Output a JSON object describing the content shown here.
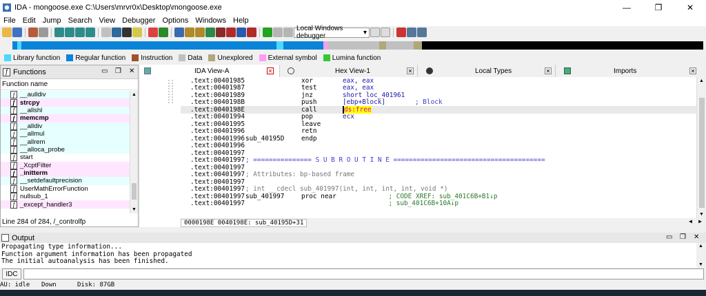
{
  "window": {
    "title": "IDA - mongoose.exe C:\\Users\\mrvr0x\\Desktop\\mongoose.exe",
    "minimize": "—",
    "restore": "❐",
    "close": "✕"
  },
  "menu": [
    "File",
    "Edit",
    "Jump",
    "Search",
    "View",
    "Debugger",
    "Options",
    "Windows",
    "Help"
  ],
  "toolbar": {
    "debugger_select": "Local Windows debugger",
    "icons": [
      "open-icon",
      "save-icon",
      "back-icon",
      "forward-icon",
      "new-icon",
      "copy-icon",
      "paste-icon",
      "edit-icon",
      "jump-icon",
      "text-icon",
      "function-icon",
      "data-icon",
      "struct-icon",
      "letters-icon",
      "ascii-icon",
      "enum-icon",
      "graph-icon",
      "list-icon",
      "run-icon",
      "pause-icon",
      "stop-icon"
    ]
  },
  "legend": [
    {
      "label": "Library function",
      "color": "#4cd8ff"
    },
    {
      "label": "Regular function",
      "color": "#0a84d8"
    },
    {
      "label": "Instruction",
      "color": "#a0522d"
    },
    {
      "label": "Data",
      "color": "#c0c0c0"
    },
    {
      "label": "Unexplored",
      "color": "#b0a87a"
    },
    {
      "label": "External symbol",
      "color": "#ff9cf2"
    },
    {
      "label": "Lumina function",
      "color": "#34c934"
    }
  ],
  "functions_panel": {
    "title": "Functions",
    "column_header": "Function name",
    "items": [
      {
        "name": "__aulldiv",
        "bold": false,
        "bg": "#e6ffff"
      },
      {
        "name": "strcpy",
        "bold": true,
        "bg": "#ffe6ff"
      },
      {
        "name": "__allshl",
        "bold": false,
        "bg": "#e6ffff"
      },
      {
        "name": "memcmp",
        "bold": true,
        "bg": "#ffe6ff"
      },
      {
        "name": "__alldiv",
        "bold": false,
        "bg": "#e6ffff"
      },
      {
        "name": "__allmul",
        "bold": false,
        "bg": "#e6ffff"
      },
      {
        "name": "__allrem",
        "bold": false,
        "bg": "#e6ffff"
      },
      {
        "name": "__alloca_probe",
        "bold": false,
        "bg": "#e6ffff"
      },
      {
        "name": "start",
        "bold": false,
        "bg": "#ffffff"
      },
      {
        "name": "_XcptFilter",
        "bold": false,
        "bg": "#ffe6ff"
      },
      {
        "name": "_initterm",
        "bold": true,
        "bg": "#ffe6ff"
      },
      {
        "name": "__setdefaultprecision",
        "bold": false,
        "bg": "#e6ffff"
      },
      {
        "name": "UserMathErrorFunction",
        "bold": false,
        "bg": "#ffffff"
      },
      {
        "name": "nullsub_1",
        "bold": false,
        "bg": "#ffffff"
      },
      {
        "name": "_except_handler3",
        "bold": false,
        "bg": "#ffe6ff"
      }
    ],
    "status": "Line 284 of 284, /_controlfp"
  },
  "tabs": [
    {
      "label": "IDA View-A",
      "active": true
    },
    {
      "label": "Hex View-1",
      "active": false
    },
    {
      "label": "Local Types",
      "active": false
    },
    {
      "label": "Imports",
      "active": false
    }
  ],
  "disassembly": [
    {
      "addr": ".text:00401985",
      "label": "",
      "mn": "xor",
      "op": "eax, eax",
      "comment": ""
    },
    {
      "addr": ".text:00401987",
      "label": "",
      "mn": "test",
      "op": "eax, eax",
      "comment": ""
    },
    {
      "addr": ".text:00401989",
      "label": "",
      "mn": "jnz",
      "op": "short loc_401961",
      "comment": ""
    },
    {
      "addr": ".text:0040198B",
      "label": "",
      "mn": "push",
      "op": "[ebp+Block]",
      "comment": "; Block"
    },
    {
      "addr": ".text:0040198E",
      "label": "",
      "mn": "call",
      "op": "ds:free",
      "comment": "",
      "highlight": true
    },
    {
      "addr": ".text:00401994",
      "label": "",
      "mn": "pop",
      "op": "ecx",
      "comment": ""
    },
    {
      "addr": ".text:00401995",
      "label": "",
      "mn": "leave",
      "op": "",
      "comment": ""
    },
    {
      "addr": ".text:00401996",
      "label": "",
      "mn": "retn",
      "op": "",
      "comment": ""
    },
    {
      "addr": ".text:00401996",
      "label": "sub_40195D",
      "mn": "endp",
      "op": "",
      "comment": ""
    },
    {
      "addr": ".text:00401996",
      "label": "",
      "mn": "",
      "op": "",
      "comment": ""
    },
    {
      "addr": ".text:00401997",
      "label": "",
      "mn": "",
      "op": "",
      "comment": ""
    },
    {
      "addr": ".text:00401997",
      "label": "",
      "mn": "",
      "op": "",
      "comment": "; =============== S U B R O U T I N E ======================================="
    },
    {
      "addr": ".text:00401997",
      "label": "",
      "mn": "",
      "op": "",
      "comment": ""
    },
    {
      "addr": ".text:00401997",
      "label": "",
      "mn": "",
      "op": "",
      "comment": "; Attributes: bp-based frame"
    },
    {
      "addr": ".text:00401997",
      "label": "",
      "mn": "",
      "op": "",
      "comment": ""
    },
    {
      "addr": ".text:00401997",
      "label": "",
      "mn": "",
      "op": "",
      "comment": "; int __cdecl sub_401997(int, int, int, int, void *)"
    },
    {
      "addr": ".text:00401997",
      "label": "sub_401997",
      "mn": "proc near",
      "op": "",
      "comment": "          ; CODE XREF: sub_401C6B+B1↓p"
    },
    {
      "addr": ".text:00401997",
      "label": "",
      "mn": "",
      "op": "",
      "comment": "          ; sub_401C6B+10A↓p"
    }
  ],
  "disasm_status": "0000198E 0040198E: sub_40195D+31",
  "output": {
    "title": "Output",
    "lines": [
      "Propagating type information...",
      "Function argument information has been propagated",
      "The initial autoanalysis has been finished."
    ]
  },
  "idc": {
    "button": "IDC"
  },
  "status": {
    "au": "AU:  idle",
    "mode": "Down",
    "disk": "Disk: 87GB"
  }
}
